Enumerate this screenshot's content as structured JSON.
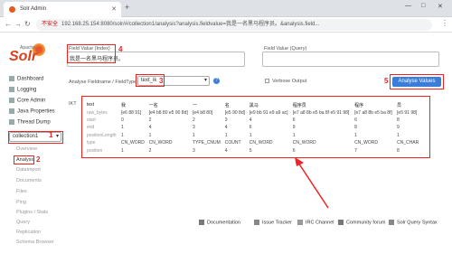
{
  "browser": {
    "tab_title": "Solr Admin",
    "new_tab": "+",
    "url_warning": "不安全",
    "url": "192.168.25.154:8080/solr/#/collection1/analysis?analysis.fieldvalue=我是一名黑马程序员。&analysis.field...",
    "window_controls": [
      "—",
      "□",
      "✕"
    ]
  },
  "logo": {
    "apache": "Apache",
    "name": "Solr"
  },
  "sidebar": {
    "items": [
      {
        "label": "Dashboard"
      },
      {
        "label": "Logging"
      },
      {
        "label": "Core Admin"
      },
      {
        "label": "Java Properties"
      },
      {
        "label": "Thread Dump"
      }
    ],
    "core_selector": "collection1",
    "core_items": [
      {
        "label": "Overview"
      },
      {
        "label": "Analysis"
      },
      {
        "label": "Dataimport"
      },
      {
        "label": "Documents"
      },
      {
        "label": "Files"
      },
      {
        "label": "Ping"
      },
      {
        "label": "Plugins / Stats"
      },
      {
        "label": "Query"
      },
      {
        "label": "Replication"
      },
      {
        "label": "Schema Browser"
      }
    ]
  },
  "main": {
    "index_label": "Field Value (Index)",
    "index_value": "我是一名黑马程序员。",
    "query_label": "Field Value (Query)",
    "query_value": "",
    "fieldname_label": "Analyse Fieldname / FieldType:",
    "fieldtype_value": "text_ik",
    "verbose_label": "Verbose Output",
    "analyse_button": "Analyse Values",
    "analyzer": "IKT"
  },
  "annotations": [
    "1",
    "2",
    "3",
    "4",
    "5"
  ],
  "table": {
    "row_headers": [
      "text",
      "raw_bytes",
      "start",
      "end",
      "positionLength",
      "type",
      "position"
    ],
    "columns": [
      [
        "我",
        "[e6 88 91]",
        "0",
        "1",
        "1",
        "CN_WORD",
        "1"
      ],
      [
        "一名",
        "[e4 b8 80 e5 90 8d]",
        "2",
        "4",
        "1",
        "CN_WORD",
        "2"
      ],
      [
        "一",
        "[e4 b8 80]",
        "2",
        "3",
        "1",
        "TYPE_CNUM",
        "3"
      ],
      [
        "名",
        "[e5 90 8d]",
        "3",
        "4",
        "1",
        "COUNT",
        "4"
      ],
      [
        "黑马",
        "[e9 bb 91 e9 a9 ac]",
        "4",
        "6",
        "1",
        "CN_WORD",
        "5"
      ],
      [
        "程序员",
        "[e7 a8 8b e5 ba 8f e5 91 98]",
        "6",
        "9",
        "1",
        "CN_WORD",
        "6"
      ],
      [
        "程序",
        "[e7 a8 8b e5 ba 8f]",
        "6",
        "8",
        "1",
        "CN_WORD",
        "7"
      ],
      [
        "员",
        "[e5 91 98]",
        "8",
        "9",
        "1",
        "CN_CHAR",
        "8"
      ]
    ]
  },
  "footer": [
    {
      "label": "Documentation"
    },
    {
      "label": "Issue Tracker"
    },
    {
      "label": "IRC Channel"
    },
    {
      "label": "Community forum"
    },
    {
      "label": "Solr Query Syntax"
    }
  ],
  "colors": {
    "accent": "#3b7dd8",
    "annotation": "#e22222",
    "brand": "#d9411e"
  }
}
